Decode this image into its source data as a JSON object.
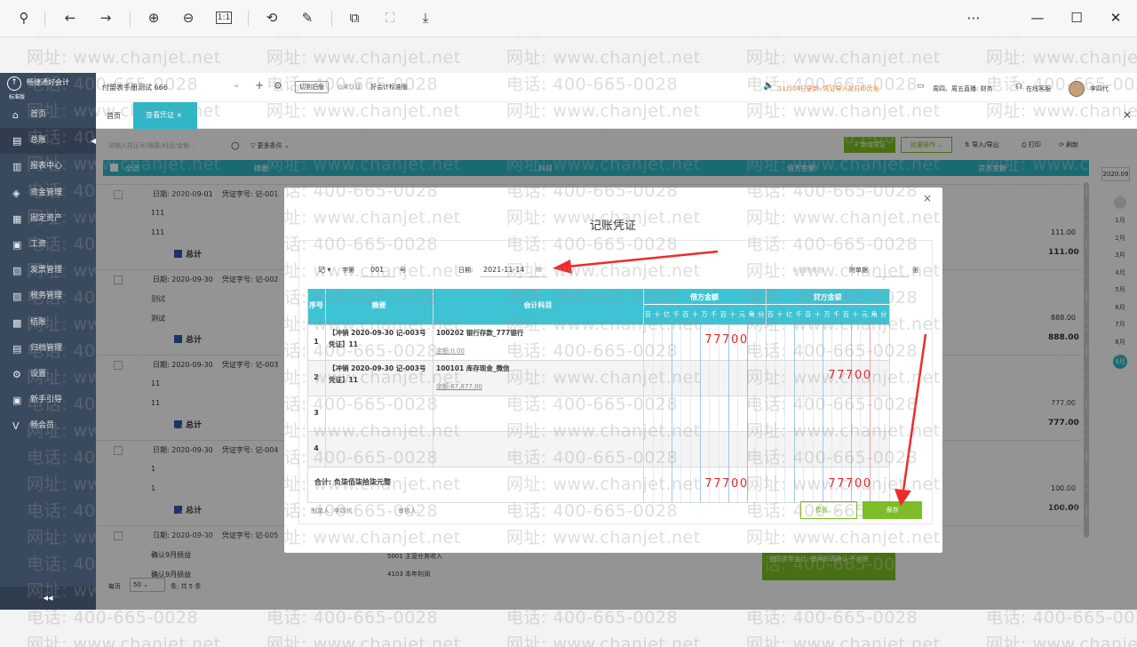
{
  "window": {
    "colors": {
      "accent": "#2db7c7",
      "green": "#7cc021",
      "red": "#e8262d",
      "sidebar": "#3a4a5e"
    }
  },
  "watermark": {
    "phone": "电话: 400-665-0028",
    "site": "网址: www.chanjet.net"
  },
  "app": {
    "brand_name": "畅捷通好会计",
    "brand_edition": "标准版",
    "account_set": "付盟表手册测试 666",
    "switch_old": "切到旧版",
    "cert_status": "未认证",
    "standard_label": "好会计标准版",
    "notice": "11月04日更新: 凭证导入及打印优化",
    "live": "周四、周五直播: 财务",
    "online_service": "在线客服",
    "user": "李四代"
  },
  "sidebar": {
    "items": [
      {
        "label": "首页",
        "icon": "home-icon",
        "glyph": "⌂"
      },
      {
        "label": "总账",
        "icon": "ledger-icon",
        "glyph": "▤"
      },
      {
        "label": "报表中心",
        "icon": "report-icon",
        "glyph": "▥"
      },
      {
        "label": "资金管理",
        "icon": "money-icon",
        "glyph": "◈"
      },
      {
        "label": "固定资产",
        "icon": "asset-icon",
        "glyph": "▦"
      },
      {
        "label": "工资",
        "icon": "salary-icon",
        "glyph": "▣"
      },
      {
        "label": "发票管理",
        "icon": "invoice-icon",
        "glyph": "▧"
      },
      {
        "label": "税务管理",
        "icon": "tax-icon",
        "glyph": "▨"
      },
      {
        "label": "结账",
        "icon": "close-books-icon",
        "glyph": "▩"
      },
      {
        "label": "归档管理",
        "icon": "archive-icon",
        "glyph": "▤"
      },
      {
        "label": "设置",
        "icon": "settings-icon",
        "glyph": "⚙"
      },
      {
        "label": "新手引导",
        "icon": "guide-icon",
        "glyph": "▣"
      },
      {
        "label": "畅会员",
        "icon": "vip-icon",
        "glyph": "V"
      }
    ]
  },
  "tabs": {
    "home": "首页",
    "view_voucher": "查看凭证"
  },
  "list": {
    "search_placeholder": "请输入凭证号/摘要/科目/金额...",
    "more_filter": "更多条件",
    "new_voucher": "+ 新增凭证",
    "batch_ops": "批量操作",
    "import_export": "导入/导出",
    "print": "打印",
    "refresh": "刷新",
    "headers": [
      "全选",
      "摘要",
      "科目",
      "借方金额",
      "贷方金额"
    ],
    "period": "2020.09",
    "months": [
      "1月",
      "2月",
      "3月",
      "4月",
      "5月",
      "6月",
      "7月",
      "8月",
      "9月"
    ],
    "groups": [
      {
        "date": "日期: 2020-09-01",
        "no": "凭证字号: 记-001",
        "rows": [
          "111",
          "111"
        ],
        "amt": "111.00",
        "total": "总计",
        "total_amt": "111.00"
      },
      {
        "date": "日期: 2020-09-30",
        "no": "凭证字号: 记-002",
        "rows": [
          "测试",
          "测试"
        ],
        "amt": "888.00",
        "total": "总计",
        "total_amt": "888.00"
      },
      {
        "date": "日期: 2020-09-30",
        "no": "凭证字号: 记-003",
        "rows": [
          "11",
          "11"
        ],
        "amt": "777.00",
        "total": "总计",
        "total_amt": "777.00"
      },
      {
        "date": "日期: 2020-09-30",
        "no": "凭证字号: 记-004",
        "rows": [
          "1",
          "1"
        ],
        "amt": "100.00",
        "total": "总计",
        "total_amt": "100.00"
      },
      {
        "date": "日期: 2020-09-30",
        "no": "凭证字号: 记-005",
        "rows": [
          "确认9月损益",
          "确认9月损益"
        ],
        "amt": "",
        "total": "",
        "total_amt": ""
      }
    ],
    "extra_row_subject": "5001 主营业务收入",
    "extra_row_subject2": "4103 本年利润",
    "page_size_label": "每页",
    "page_size": "50",
    "page_info": "条, 共 5 条",
    "toast": "相同类型会计, 使用前请确认 不会是"
  },
  "modal": {
    "title": "记账凭证",
    "word": "记",
    "word_no_label": "字第",
    "word_no": "001",
    "no_suffix": "号",
    "date_label": "日期:",
    "date_value": "2021-11-14",
    "delete_attach": "删除本张",
    "attach_label": "附单据",
    "attach_suffix": "张",
    "headers": {
      "seq": "序号",
      "summary": "摘要",
      "account": "会计科目",
      "debit": "借方金额",
      "credit": "贷方金额"
    },
    "digit_units": [
      "百",
      "十",
      "亿",
      "千",
      "百",
      "十",
      "万",
      "千",
      "百",
      "十",
      "元",
      "角",
      "分"
    ],
    "rows": [
      {
        "seq": "1",
        "summary": "【冲销 2020-09-30 记-003号凭证】11",
        "account": "100202 银行存款_777银行",
        "balance": "余额:0.00",
        "debit": "77700",
        "credit": ""
      },
      {
        "seq": "2",
        "summary": "【冲销 2020-09-30 记-003号凭证】11",
        "account": "100101 库存现金_微信",
        "balance": "余额:67,877.00",
        "debit": "",
        "credit": "77700"
      },
      {
        "seq": "3",
        "summary": "",
        "account": "",
        "balance": "",
        "debit": "",
        "credit": ""
      },
      {
        "seq": "4",
        "summary": "",
        "account": "",
        "balance": "",
        "debit": "",
        "credit": ""
      }
    ],
    "total_label": "合计: 负柒佰柒拾柒元整",
    "total_debit": "77700",
    "total_credit": "77700",
    "maker": "制单人: 李四代",
    "auditor": "审核人:",
    "template_btn": "模板",
    "save_btn": "保存"
  }
}
